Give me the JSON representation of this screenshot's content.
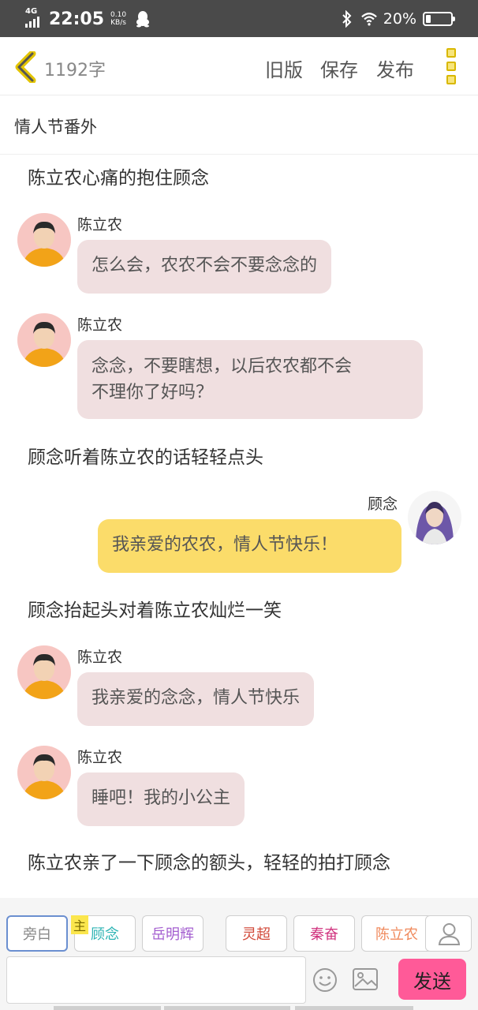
{
  "status_bar": {
    "network": "4G",
    "time": "22:05",
    "speed_value": "0.10",
    "speed_unit": "KB/s",
    "battery_text": "20%",
    "battery_level": 0.2
  },
  "toolbar": {
    "word_count": "1192字",
    "old_version": "旧版",
    "save": "保存",
    "publish": "发布"
  },
  "chapter_title": "情人节番外",
  "messages": {
    "narration_1": "陈立农心痛的抱住顾念",
    "m1": {
      "name": "陈立农",
      "text": "怎么会，农农不会不要念念的"
    },
    "m2": {
      "name": "陈立农",
      "text_line1": "念念，不要瞎想，以后农农都不会",
      "text_line2": "不理你了好吗？"
    },
    "narration_2": "顾念听着陈立农的话轻轻点头",
    "m3": {
      "name": "顾念",
      "text": "我亲爱的农农，情人节快乐！"
    },
    "narration_3": "顾念抬起头对着陈立农灿烂一笑",
    "m4": {
      "name": "陈立农",
      "text": "我亲爱的念念，情人节快乐"
    },
    "m5": {
      "name": "陈立农",
      "text": "睡吧！我的小公主"
    },
    "narration_4": "陈立农亲了一下顾念的额头，轻轻的拍打顾念"
  },
  "roles": {
    "main_tag": "主",
    "items": [
      "旁白",
      "顾念",
      "岳明辉",
      "灵超",
      "秦奋",
      "陈立农"
    ],
    "colors": [
      "#888888",
      "#2bb3b3",
      "#a45fd0",
      "#d24a3a",
      "#d0327e",
      "#f08a5d"
    ]
  },
  "input": {
    "placeholder": ""
  },
  "send_label": "发送",
  "icons": {
    "back": "chevron-left-icon",
    "more": "more-vertical-icon",
    "person": "person-icon",
    "emoji": "emoji-icon",
    "image": "image-icon"
  }
}
